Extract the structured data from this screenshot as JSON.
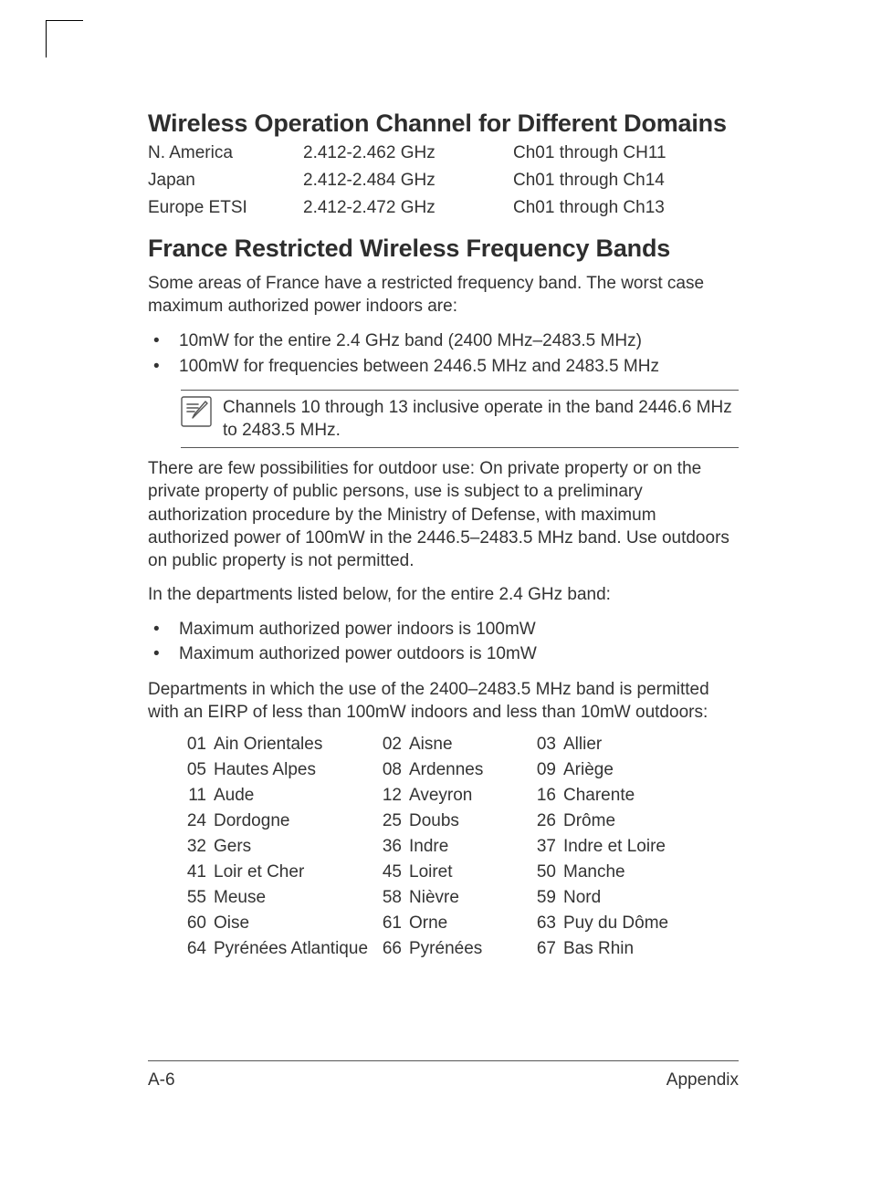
{
  "headings": {
    "section1": "Wireless Operation Channel for Different Domains",
    "section2": "France Restricted Wireless Frequency Bands"
  },
  "domains": [
    {
      "region": "N. America",
      "freq": "2.412-2.462 GHz",
      "ch": "Ch01 through CH11"
    },
    {
      "region": "Japan",
      "freq": "2.412-2.484 GHz",
      "ch": "Ch01 through Ch14"
    },
    {
      "region": "Europe ETSI",
      "freq": "2.412-2.472 GHz",
      "ch": "Ch01 through Ch13"
    }
  ],
  "france_intro": "Some areas of France have a restricted frequency band. The worst case maximum authorized power indoors are:",
  "france_bullets1": [
    "10mW for the entire 2.4 GHz band (2400 MHz–2483.5 MHz)",
    "100mW for frequencies between 2446.5 MHz and 2483.5 MHz"
  ],
  "note": "Channels 10 through 13 inclusive operate in the band 2446.6 MHz to 2483.5 MHz.",
  "france_para2": "There are few possibilities for outdoor use: On private property or on the private property of public persons, use is subject to a preliminary authorization procedure by the Ministry of Defense, with maximum authorized power of 100mW in the 2446.5–2483.5 MHz band. Use outdoors on public property is not permitted.",
  "france_para3": "In the departments listed below, for the entire 2.4 GHz band:",
  "france_bullets2": [
    "Maximum authorized power indoors is 100mW",
    "Maximum authorized power outdoors is 10mW"
  ],
  "france_para4": "Departments in which the use of the 2400–2483.5 MHz band is permitted with an EIRP of less than 100mW indoors and less than 10mW outdoors:",
  "departments": [
    {
      "num": "01",
      "name": "Ain Orientales"
    },
    {
      "num": "02",
      "name": "Aisne"
    },
    {
      "num": "03",
      "name": "Allier"
    },
    {
      "num": "05",
      "name": "Hautes Alpes"
    },
    {
      "num": "08",
      "name": "Ardennes"
    },
    {
      "num": "09",
      "name": "Ariège"
    },
    {
      "num": "11",
      "name": "Aude"
    },
    {
      "num": "12",
      "name": "Aveyron"
    },
    {
      "num": "16",
      "name": "Charente"
    },
    {
      "num": "24",
      "name": "Dordogne"
    },
    {
      "num": "25",
      "name": "Doubs"
    },
    {
      "num": "26",
      "name": "Drôme"
    },
    {
      "num": "32",
      "name": "Gers"
    },
    {
      "num": "36",
      "name": "Indre"
    },
    {
      "num": "37",
      "name": "Indre et Loire"
    },
    {
      "num": "41",
      "name": "Loir et Cher"
    },
    {
      "num": "45",
      "name": "Loiret"
    },
    {
      "num": "50",
      "name": "Manche"
    },
    {
      "num": "55",
      "name": "Meuse"
    },
    {
      "num": "58",
      "name": "Nièvre"
    },
    {
      "num": "59",
      "name": "Nord"
    },
    {
      "num": "60",
      "name": "Oise"
    },
    {
      "num": "61",
      "name": "Orne"
    },
    {
      "num": "63",
      "name": "Puy du Dôme"
    },
    {
      "num": "64",
      "name": "Pyrénées Atlantique"
    },
    {
      "num": "66",
      "name": "Pyrénées"
    },
    {
      "num": "67",
      "name": "Bas Rhin"
    }
  ],
  "footer": {
    "left": "A-6",
    "right": "Appendix"
  }
}
